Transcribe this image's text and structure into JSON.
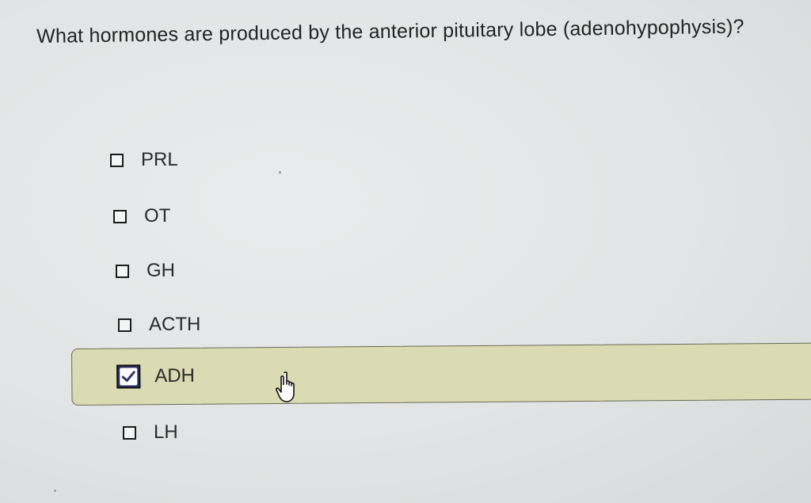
{
  "question": {
    "text": "What hormones are produced by the anterior pituitary lobe (adenohypophysis)?"
  },
  "options": [
    {
      "label": "PRL",
      "checked": false
    },
    {
      "label": "OT",
      "checked": false
    },
    {
      "label": "GH",
      "checked": false
    },
    {
      "label": "ACTH",
      "checked": false
    },
    {
      "label": "ADH",
      "checked": true
    },
    {
      "label": "LH",
      "checked": false
    }
  ],
  "icons": {
    "check": "check-icon",
    "cursor": "hand-pointer-icon"
  },
  "colors": {
    "selected_row_bg": "#dadab3",
    "checked_box_bg": "#2f3569",
    "background": "#e4e6e7"
  }
}
